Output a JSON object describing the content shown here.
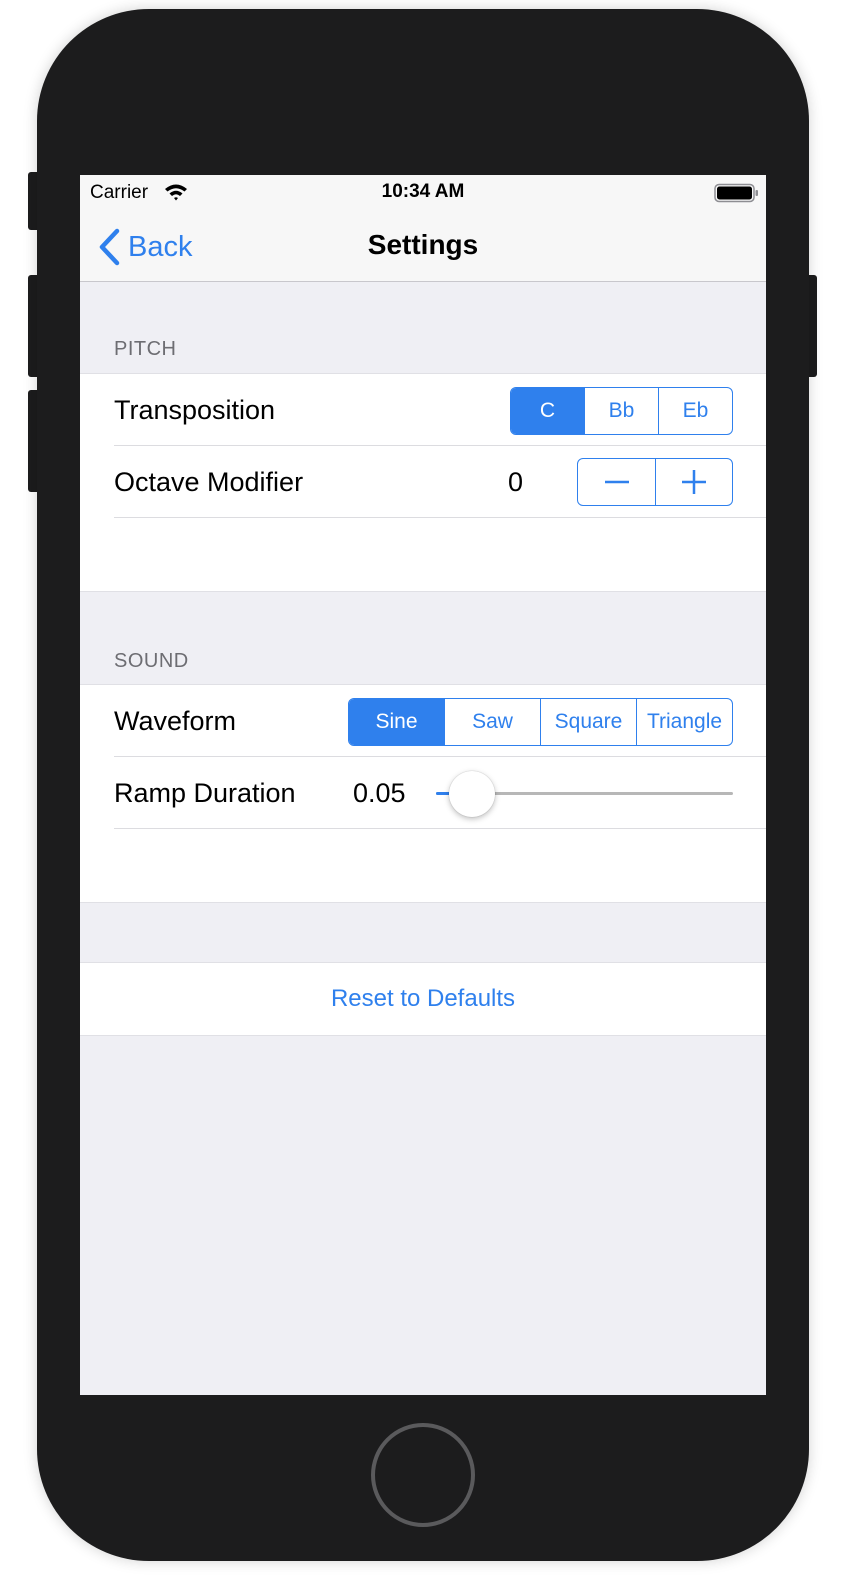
{
  "status_bar": {
    "carrier": "Carrier",
    "time": "10:34 AM",
    "wifi_icon": "wifi-icon",
    "battery_icon": "battery-full-icon"
  },
  "nav": {
    "back_label": "Back",
    "title": "Settings"
  },
  "pitch": {
    "header": "PITCH",
    "transposition": {
      "label": "Transposition",
      "options": [
        "C",
        "Bb",
        "Eb"
      ],
      "selected": "C"
    },
    "octave": {
      "label": "Octave Modifier",
      "value": "0"
    }
  },
  "sound": {
    "header": "SOUND",
    "waveform": {
      "label": "Waveform",
      "options": [
        "Sine",
        "Saw",
        "Square",
        "Triangle"
      ],
      "selected": "Sine"
    },
    "ramp": {
      "label": "Ramp Duration",
      "value": "0.05",
      "slider_fraction": 0.12
    }
  },
  "reset_label": "Reset to Defaults",
  "colors": {
    "accent": "#2f80ed",
    "background": "#efeff4",
    "device": "#1c1c1d"
  }
}
